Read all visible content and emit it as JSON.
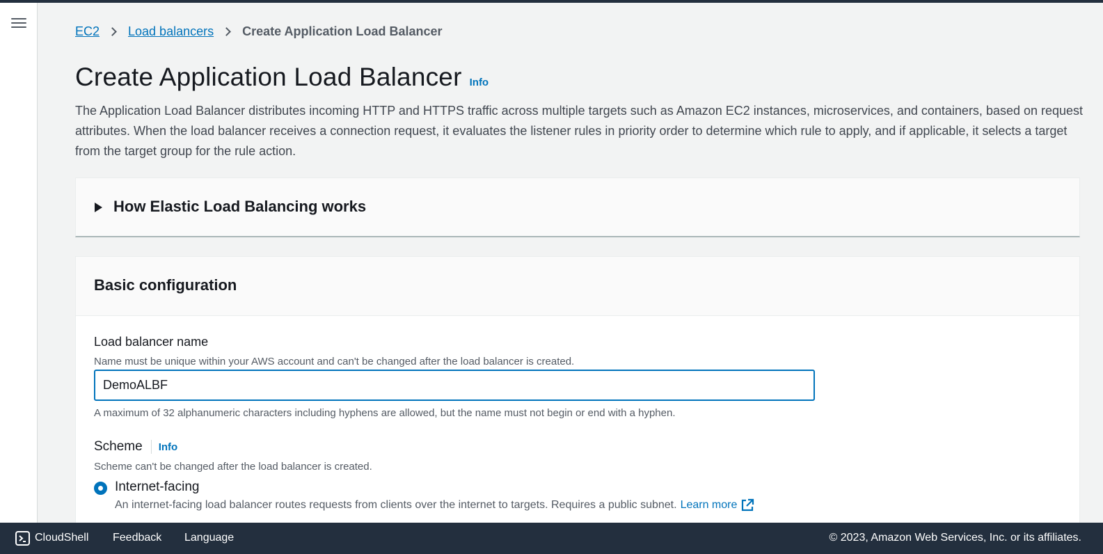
{
  "breadcrumb": {
    "items": [
      "EC2",
      "Load balancers"
    ],
    "current": "Create Application Load Balancer"
  },
  "page": {
    "title": "Create Application Load Balancer",
    "info_label": "Info",
    "description": "The Application Load Balancer distributes incoming HTTP and HTTPS traffic across multiple targets such as Amazon EC2 instances, microservices, and containers, based on request attributes. When the load balancer receives a connection request, it evaluates the listener rules in priority order to determine which rule to apply, and if applicable, it selects a target from the target group for the rule action."
  },
  "expander": {
    "title": "How Elastic Load Balancing works"
  },
  "basic_config": {
    "title": "Basic configuration",
    "name_field": {
      "label": "Load balancer name",
      "description": "Name must be unique within your AWS account and can't be changed after the load balancer is created.",
      "value": "DemoALBF",
      "constraint": "A maximum of 32 alphanumeric characters including hyphens are allowed, but the name must not begin or end with a hyphen."
    },
    "scheme": {
      "label": "Scheme",
      "info_label": "Info",
      "description": "Scheme can't be changed after the load balancer is created.",
      "options": [
        {
          "label": "Internet-facing",
          "selected": true,
          "description": "An internet-facing load balancer routes requests from clients over the internet to targets. Requires a public subnet.",
          "link": "Learn more"
        }
      ]
    }
  },
  "footer": {
    "cloudshell": "CloudShell",
    "feedback": "Feedback",
    "language": "Language",
    "copyright": "© 2023, Amazon Web Services, Inc. or its affiliates."
  },
  "colors": {
    "link": "#0073bb",
    "header_dark": "#232f3e",
    "background": "#f2f3f3"
  }
}
